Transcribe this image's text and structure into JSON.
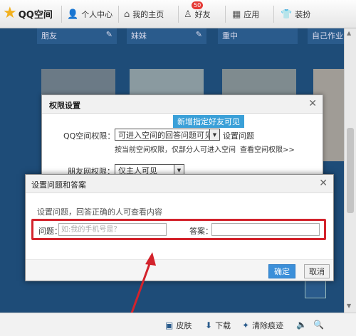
{
  "topbar": {
    "brand": "QQ空间",
    "nav": [
      {
        "label": "个人中心",
        "icon": "person-icon"
      },
      {
        "label": "我的主页",
        "icon": "home-icon"
      },
      {
        "label": "好友",
        "icon": "friends-icon",
        "badge": "50"
      },
      {
        "label": "应用",
        "icon": "apps-icon"
      },
      {
        "label": "装扮",
        "icon": "shirt-icon"
      }
    ]
  },
  "background": {
    "tiles": [
      "朋友",
      "妹妹",
      "重中",
      "自己作业"
    ]
  },
  "permission_dialog": {
    "title": "权限设置",
    "qq_label": "QQ空间权限：",
    "qq_value": "可进入空间的回答问题可见",
    "tooltip": "新增指定好友可见",
    "set_question_link": "设置问题",
    "notice": "按当前空间权限，仅部分人可进入空间",
    "view_link": "查看空间权限>>",
    "pengyou_label": "朋友网权限：",
    "pengyou_value": "仅主人可见"
  },
  "qa_dialog": {
    "title": "设置问题和答案",
    "description": "设置问题，回答正确的人可查看内容",
    "question_label": "问题：",
    "question_placeholder": "如:我的手机号是？",
    "answer_label": "答案：",
    "answer_value": "",
    "confirm_label": "确定",
    "cancel_label": "取消"
  },
  "bottombar": {
    "items": [
      {
        "label": "皮肤",
        "icon": "skin-icon"
      },
      {
        "label": "下载",
        "icon": "download-icon"
      },
      {
        "label": "清除痕迹",
        "icon": "broom-icon"
      }
    ]
  },
  "colors": {
    "highlight_red": "#d3232c",
    "primary_blue": "#3b8fd9"
  }
}
